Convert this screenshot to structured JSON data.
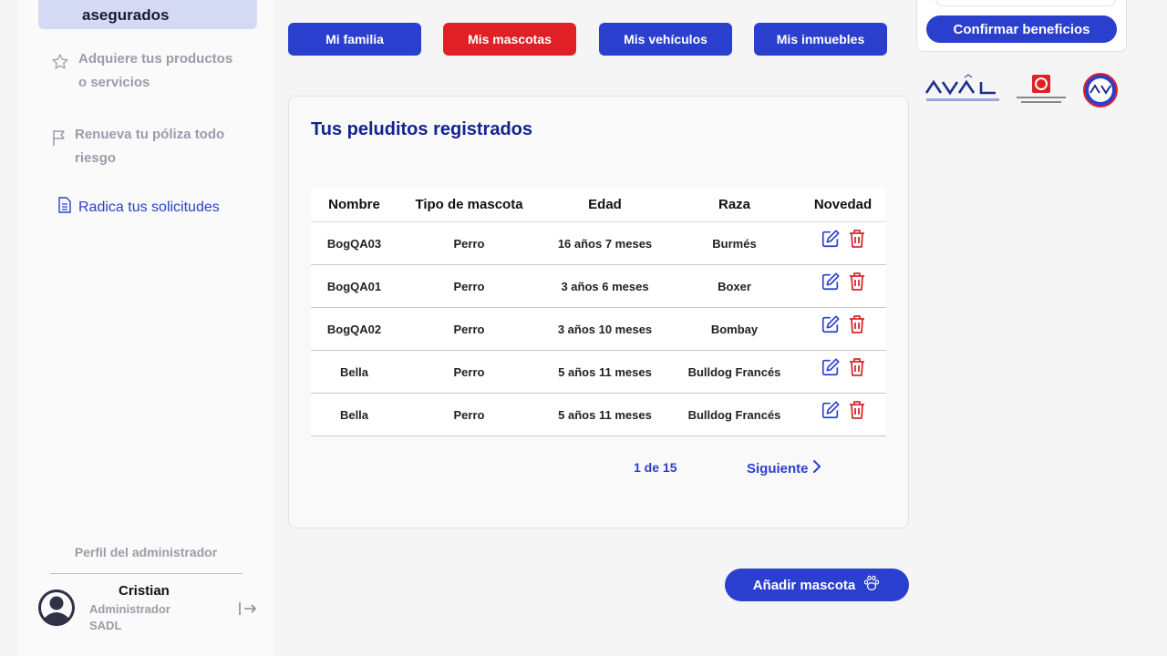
{
  "sidebar": {
    "active_item": "asegurados",
    "items": [
      {
        "label_line1": "Adquiere tus productos",
        "label_line2": "o servicios",
        "icon": "star-icon"
      },
      {
        "label_line1": "Renueva tu póliza todo",
        "label_line2": "riesgo",
        "icon": "flag-icon"
      }
    ],
    "link": {
      "label": "Radica tus solicitudes",
      "icon": "document-icon"
    },
    "profile_title": "Perfil del administrador",
    "user": {
      "name": "Cristian",
      "role": "Administrador",
      "org": "SADL"
    }
  },
  "tabs": [
    {
      "label": "Mi familia",
      "active": false
    },
    {
      "label": "Mis mascotas",
      "active": true
    },
    {
      "label": "Mis vehículos",
      "active": false
    },
    {
      "label": "Mis inmuebles",
      "active": false
    }
  ],
  "pets": {
    "title": "Tus peluditos registrados",
    "columns": [
      "Nombre",
      "Tipo de mascota",
      "Edad",
      "Raza",
      "Novedad"
    ],
    "rows": [
      {
        "nombre": "BogQA03",
        "tipo": "Perro",
        "edad": "16 años 7 meses",
        "raza": "Burmés"
      },
      {
        "nombre": "BogQA01",
        "tipo": "Perro",
        "edad": "3 años 6 meses",
        "raza": "Boxer"
      },
      {
        "nombre": "BogQA02",
        "tipo": "Perro",
        "edad": "3 años 10 meses",
        "raza": "Bombay"
      },
      {
        "nombre": "Bella",
        "tipo": "Perro",
        "edad": "5 años 11 meses",
        "raza": "Bulldog Francés"
      },
      {
        "nombre": "Bella",
        "tipo": "Perro",
        "edad": "5 años 11 meses",
        "raza": "Bulldog Francés"
      }
    ],
    "pager": {
      "count": "1 de 15",
      "next": "Siguiente"
    },
    "add_button": "Añadir mascota"
  },
  "right_panel": {
    "confirm_button": "Confirmar beneficios"
  },
  "colors": {
    "primary": "#2b3fcf",
    "active_tab": "#e11f26",
    "title": "#13238f",
    "delete": "#d42a2a"
  }
}
